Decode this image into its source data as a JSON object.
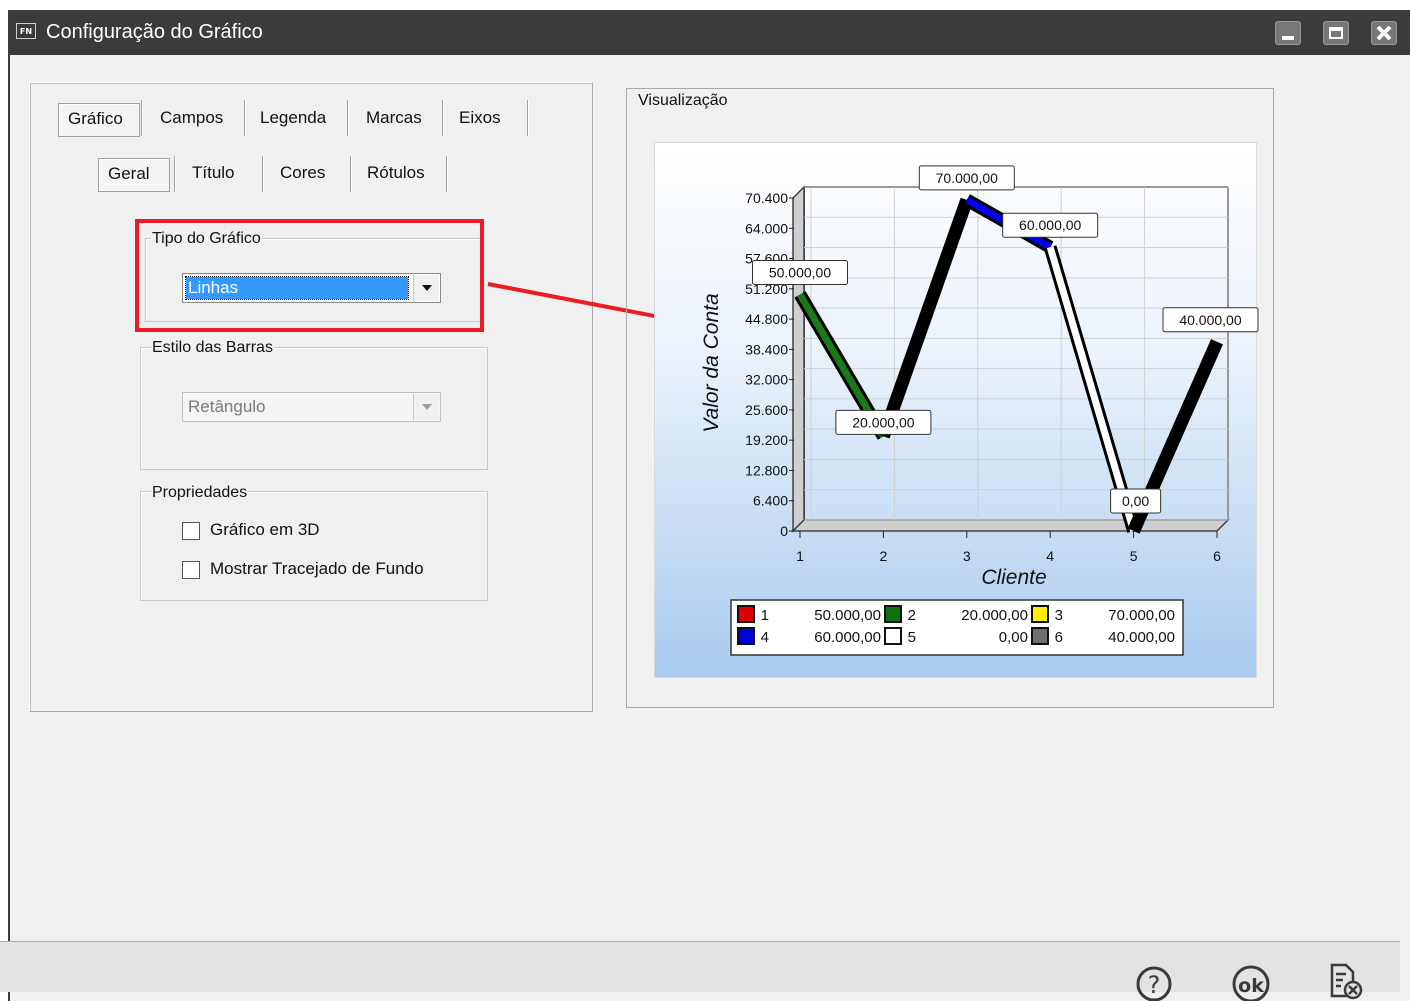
{
  "window": {
    "app_icon_text": "FN",
    "title": "Configuração do Gráfico"
  },
  "tabs_main": [
    "Gráfico",
    "Campos",
    "Legenda",
    "Marcas",
    "Eixos"
  ],
  "tabs_sub": [
    "Geral",
    "Título",
    "Cores",
    "Rótulos"
  ],
  "tipo": {
    "label": "Tipo do Gráfico",
    "value": "Linhas"
  },
  "estilo": {
    "label": "Estilo das Barras",
    "value": "Retângulo"
  },
  "propriedades": {
    "label": "Propriedades",
    "opt3d": "Gráfico em 3D",
    "opt3d_checked": false,
    "optgrid": "Mostrar Tracejado de Fundo",
    "optgrid_checked": false
  },
  "preview": {
    "label": "Visualização"
  },
  "chart_data": {
    "type": "line",
    "xlabel": "Cliente",
    "ylabel": "Valor da Conta",
    "categories": [
      "1",
      "2",
      "3",
      "4",
      "5",
      "6"
    ],
    "values": [
      50000,
      20000,
      70000,
      60000,
      0,
      40000
    ],
    "data_labels": [
      "50.000,00",
      "20.000,00",
      "70.000,00",
      "60.000,00",
      "0,00",
      "40.000,00"
    ],
    "yticks": [
      "0",
      "6.400",
      "12.800",
      "19.200",
      "25.600",
      "32.000",
      "38.400",
      "44.800",
      "51.200",
      "57.600",
      "64.000",
      "70.400"
    ],
    "ylim": [
      0,
      70400
    ],
    "segment_colors": [
      "#1a7a1a",
      "#000000",
      "#0000ee",
      "#ffffff",
      "#000000"
    ],
    "legend": [
      {
        "num": "1",
        "value": "50.000,00",
        "color": "#e00000"
      },
      {
        "num": "2",
        "value": "20.000,00",
        "color": "#107010"
      },
      {
        "num": "3",
        "value": "70.000,00",
        "color": "#ffee00"
      },
      {
        "num": "4",
        "value": "60.000,00",
        "color": "#0000dd"
      },
      {
        "num": "5",
        "value": "0,00",
        "color": "#ffffff"
      },
      {
        "num": "6",
        "value": "40.000,00",
        "color": "#707070"
      }
    ]
  },
  "bottom": {
    "help_icon": "help-icon",
    "ok_icon": "ok-icon",
    "ok_label": "ok",
    "cancel_icon": "cancel-document-icon"
  }
}
